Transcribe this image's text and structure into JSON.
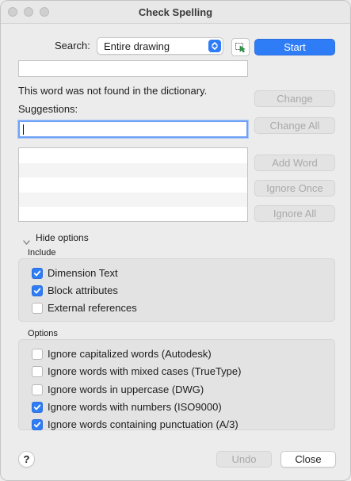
{
  "window": {
    "title": "Check Spelling"
  },
  "search": {
    "label": "Search:",
    "selected": "Entire drawing"
  },
  "buttons": {
    "start": "Start",
    "change": "Change",
    "change_all": "Change All",
    "add_word": "Add Word",
    "ignore_once": "Ignore Once",
    "ignore_all": "Ignore All",
    "undo": "Undo",
    "close": "Close",
    "help": "?"
  },
  "current_word": {
    "value": ""
  },
  "message": "This word was not found in the dictionary.",
  "suggestions": {
    "label": "Suggestions:",
    "value": ""
  },
  "options_toggle": "Hide options",
  "include": {
    "title": "Include",
    "items": [
      {
        "label": "Dimension Text",
        "checked": true
      },
      {
        "label": "Block attributes",
        "checked": true
      },
      {
        "label": "External references",
        "checked": false
      }
    ]
  },
  "options": {
    "title": "Options",
    "items": [
      {
        "label": "Ignore capitalized words (Autodesk)",
        "checked": false
      },
      {
        "label": "Ignore words with mixed cases (TrueType)",
        "checked": false
      },
      {
        "label": "Ignore words in uppercase (DWG)",
        "checked": false
      },
      {
        "label": "Ignore words with numbers (ISO9000)",
        "checked": true
      },
      {
        "label": "Ignore words containing punctuation (A/3)",
        "checked": true
      }
    ]
  },
  "colors": {
    "accent": "#2f7df6"
  }
}
